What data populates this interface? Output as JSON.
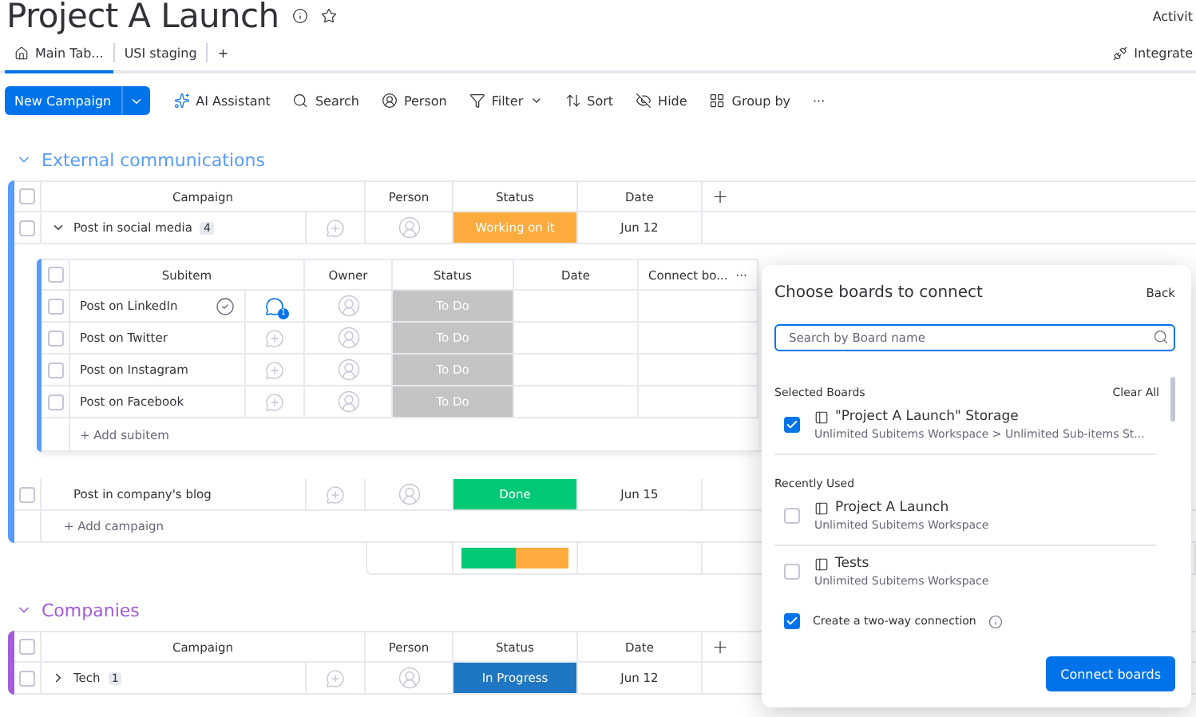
{
  "board": {
    "title": "Project A Launch",
    "activity": "Activit",
    "integrate": "Integrate",
    "tabs": [
      {
        "label": "Main Tab...",
        "selected": true
      },
      {
        "label": "USI staging",
        "selected": false
      }
    ],
    "add_tab": "+"
  },
  "toolbar": {
    "primary": "New Campaign",
    "items": [
      {
        "kind": "ai",
        "label": "AI Assistant"
      },
      {
        "kind": "search",
        "label": "Search"
      },
      {
        "kind": "person",
        "label": "Person"
      },
      {
        "kind": "filter",
        "label": "Filter"
      },
      {
        "kind": "sort",
        "label": "Sort"
      },
      {
        "kind": "hide",
        "label": "Hide"
      },
      {
        "kind": "group",
        "label": "Group by"
      },
      {
        "kind": "more",
        "label": "···"
      }
    ]
  },
  "groups": [
    {
      "title": "External communications",
      "color": "#579bfc",
      "expanded": true,
      "all_checked": false,
      "columns": [
        "Campaign",
        "Person",
        "Status",
        "Date"
      ],
      "add_column": "+",
      "items": [
        {
          "name": "Post in social media",
          "count": "4",
          "expanded": true,
          "checked": false,
          "status": {
            "label": "Working on it",
            "color": "#fdab3d"
          },
          "date": "Jun 12",
          "subitems": {
            "all_checked": false,
            "columns": [
              "Subitem",
              "Owner",
              "Status",
              "Date",
              "Connect bo..."
            ],
            "more": "···",
            "add_label": "+ Add subitem",
            "rows": [
              {
                "name": "Post on LinkedIn",
                "checked": false,
                "hover": true,
                "updates": "1",
                "status": {
                  "label": "To Do",
                  "color": "#c4c4c4"
                }
              },
              {
                "name": "Post on Twitter",
                "checked": false,
                "hover": false,
                "status": {
                  "label": "To Do",
                  "color": "#c4c4c4"
                }
              },
              {
                "name": "Post on Instagram",
                "checked": false,
                "hover": false,
                "status": {
                  "label": "To Do",
                  "color": "#c4c4c4"
                }
              },
              {
                "name": "Post on Facebook",
                "checked": false,
                "hover": false,
                "status": {
                  "label": "To Do",
                  "color": "#c4c4c4"
                }
              }
            ]
          }
        },
        {
          "name": "Post in company's blog",
          "checked": false,
          "status": {
            "label": "Done",
            "color": "#00c875"
          },
          "date": "Jun 15"
        }
      ],
      "add_label": "+ Add campaign",
      "summary": [
        {
          "color": "#00c875",
          "level": 0.5
        },
        {
          "color": "#fdab3d",
          "level": 0.5
        }
      ]
    },
    {
      "title": "Companies",
      "color": "#a25ddc",
      "expanded": true,
      "all_checked": false,
      "columns": [
        "Campaign",
        "Person",
        "Status",
        "Date"
      ],
      "add_column": "+",
      "items": [
        {
          "name": "Tech",
          "count": "1",
          "expanded": false,
          "checked": false,
          "status": {
            "label": "In Progress",
            "color": "#1f76c2"
          },
          "date": "Jun 12"
        }
      ]
    }
  ],
  "connect_dialog": {
    "title": "Choose boards to connect",
    "back": "Back",
    "search_placeholder": "Search by Board name",
    "selected_label": "Selected Boards",
    "clear_all": "Clear All",
    "selected": [
      {
        "name": "\"Project A Launch\" Storage",
        "path": "Unlimited Subitems Workspace > Unlimited Sub-items St...",
        "checked": true
      }
    ],
    "recent_label": "Recently Used",
    "recent": [
      {
        "name": "Project A Launch",
        "path": "Unlimited Subitems Workspace",
        "checked": false
      },
      {
        "name": "Tests",
        "path": "Unlimited Subitems Workspace",
        "checked": false
      }
    ],
    "two_way": {
      "label": "Create a two-way connection",
      "checked": true
    },
    "submit": "Connect boards"
  }
}
